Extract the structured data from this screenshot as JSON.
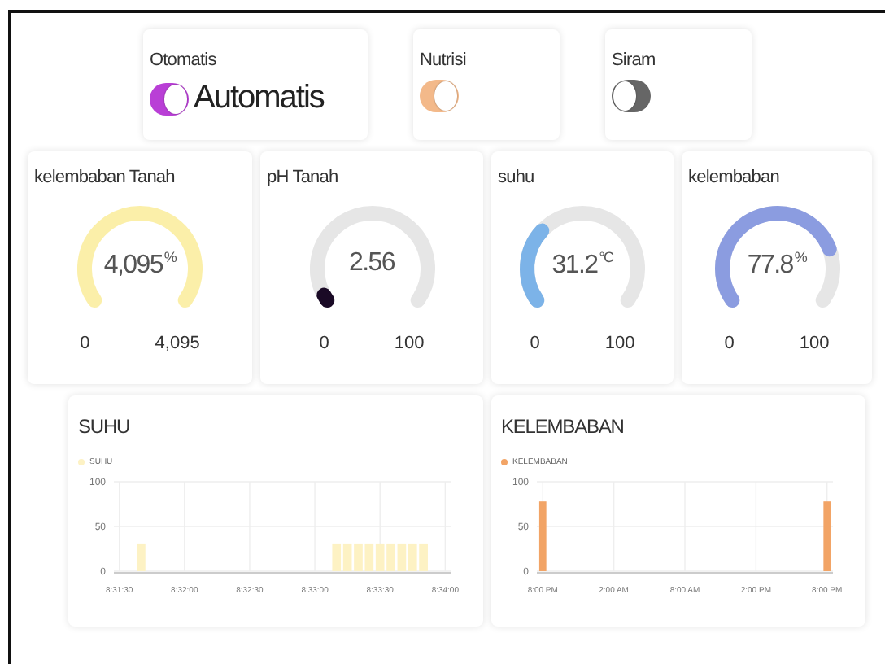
{
  "switches": [
    {
      "label": "Otomatis",
      "on": true,
      "color": "#b93fd6",
      "state_text": "Automatis"
    },
    {
      "label": "Nutrisi",
      "on": true,
      "color": "#f3b98a"
    },
    {
      "label": "Siram",
      "on": false,
      "color": "#666666"
    }
  ],
  "gauges": [
    {
      "title": "kelembaban Tanah",
      "value": "4,095",
      "unit": "%",
      "min": "0",
      "max": "4,095",
      "color": "#fbefa9"
    },
    {
      "title": "pH Tanah",
      "value": "2.56",
      "min": "0",
      "max": "100",
      "color": "#1a0a26"
    },
    {
      "title": "suhu",
      "value": "31.2",
      "unit": "°C",
      "min": "0",
      "max": "100",
      "color": "#7cb3e8"
    },
    {
      "title": "kelembaban",
      "value": "77.8",
      "unit": "%",
      "min": "0",
      "max": "100",
      "color": "#8b9ce0"
    }
  ],
  "charts": [
    {
      "title": "SUHU",
      "chart_data": {
        "type": "bar",
        "categories": [
          "8:31:30",
          null,
          null,
          null,
          null,
          null,
          "8:32:00",
          null,
          null,
          null,
          null,
          null,
          "8:32:30",
          null,
          null,
          null,
          null,
          null,
          "8:33:00",
          null,
          null,
          null,
          null,
          null,
          "8:33:30",
          null,
          null,
          null,
          null,
          null,
          "8:34:00"
        ],
        "series": [
          {
            "name": "SUHU",
            "color": "#fdf2c4",
            "values": [
              null,
              null,
              31,
              null,
              null,
              null,
              null,
              null,
              null,
              null,
              null,
              null,
              null,
              null,
              null,
              null,
              null,
              null,
              null,
              null,
              31,
              31,
              31,
              31,
              31,
              31,
              31,
              31,
              31,
              null,
              null
            ]
          }
        ],
        "ylim": [
          0,
          100
        ],
        "yticks": [
          0,
          50,
          100
        ],
        "grid": true
      }
    },
    {
      "title": "KELEMBABAN",
      "chart_data": {
        "type": "bar",
        "categories": [
          "8:00 PM",
          null,
          null,
          null,
          null,
          null,
          "2:00 AM",
          null,
          null,
          null,
          null,
          null,
          "8:00 AM",
          null,
          null,
          null,
          null,
          null,
          "2:00 PM",
          null,
          null,
          null,
          null,
          null,
          "8:00 PM"
        ],
        "series": [
          {
            "name": "KELEMBABAN",
            "color": "#f2a466",
            "values": [
              78,
              null,
              null,
              null,
              null,
              null,
              null,
              null,
              null,
              null,
              null,
              null,
              null,
              null,
              null,
              null,
              null,
              null,
              null,
              null,
              null,
              null,
              null,
              null,
              78
            ]
          }
        ],
        "ylim": [
          0,
          100
        ],
        "yticks": [
          0,
          50,
          100
        ],
        "grid": true
      }
    }
  ]
}
